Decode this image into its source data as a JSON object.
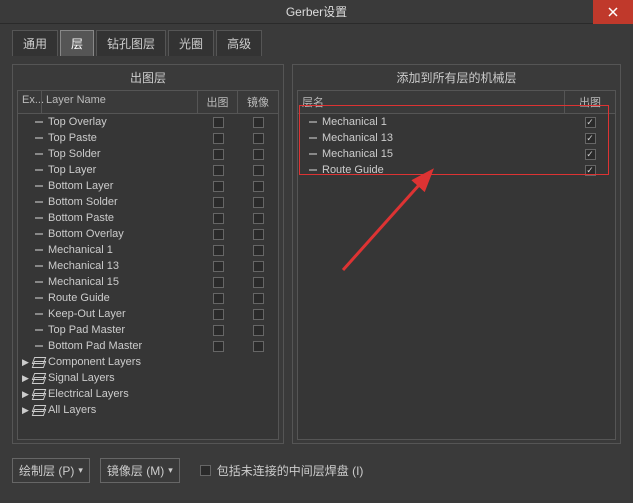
{
  "title": "Gerber设置",
  "close_icon": "close",
  "tabs": [
    "通用",
    "层",
    "钻孔图层",
    "光圈",
    "高级"
  ],
  "active_tab": 1,
  "left": {
    "title": "出图层",
    "cols": {
      "ex": "Ex...",
      "name": "Layer Name",
      "plot": "出图",
      "mirror": "镜像"
    },
    "rows": [
      {
        "type": "leaf",
        "name": "Top Overlay"
      },
      {
        "type": "leaf",
        "name": "Top Paste"
      },
      {
        "type": "leaf",
        "name": "Top Solder"
      },
      {
        "type": "leaf",
        "name": "Top Layer"
      },
      {
        "type": "leaf",
        "name": "Bottom Layer"
      },
      {
        "type": "leaf",
        "name": "Bottom Solder"
      },
      {
        "type": "leaf",
        "name": "Bottom Paste"
      },
      {
        "type": "leaf",
        "name": "Bottom Overlay"
      },
      {
        "type": "leaf",
        "name": "Mechanical 1"
      },
      {
        "type": "leaf",
        "name": "Mechanical 13"
      },
      {
        "type": "leaf",
        "name": "Mechanical 15"
      },
      {
        "type": "leaf",
        "name": "Route Guide"
      },
      {
        "type": "leaf",
        "name": "Keep-Out Layer"
      },
      {
        "type": "leaf",
        "name": "Top Pad Master"
      },
      {
        "type": "leaf",
        "name": "Bottom Pad Master"
      },
      {
        "type": "group",
        "name": "Component Layers"
      },
      {
        "type": "group",
        "name": "Signal Layers"
      },
      {
        "type": "group",
        "name": "Electrical Layers"
      },
      {
        "type": "group",
        "name": "All Layers"
      }
    ]
  },
  "right": {
    "title": "添加到所有层的机械层",
    "cols": {
      "name": "层名",
      "plot": "出图"
    },
    "rows": [
      {
        "name": "Mechanical 1",
        "checked": true
      },
      {
        "name": "Mechanical 13",
        "checked": true
      },
      {
        "name": "Mechanical 15",
        "checked": true
      },
      {
        "name": "Route Guide",
        "checked": true
      }
    ]
  },
  "bottom": {
    "plot_layer": "绘制层 (P)",
    "mirror_layer": "镜像层 (M)",
    "include_unconnected": "包括未连接的中间层焊盘 (I)"
  }
}
